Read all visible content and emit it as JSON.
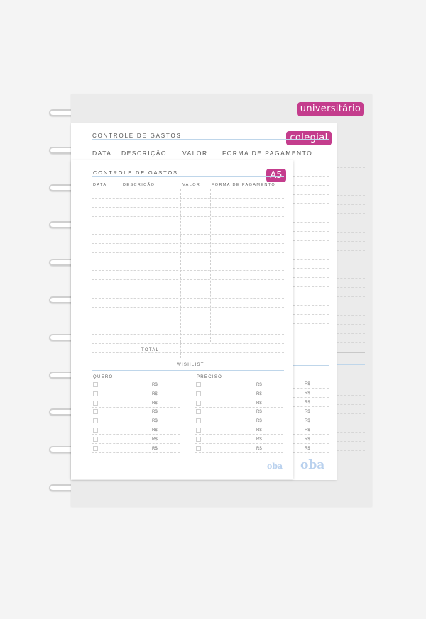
{
  "badges": {
    "universitario": "universitário",
    "colegial": "colegial",
    "a5": "A5"
  },
  "form": {
    "title": "CONTROLE DE GASTOS",
    "columns": [
      "DATA",
      "DESCRIÇÃO",
      "VALOR",
      "FORMA DE PAGAMENTO"
    ],
    "total": "TOTAL",
    "wishlist": "WISHLIST",
    "quero": "QUERO",
    "preciso": "PRECISO",
    "currency": "R$"
  },
  "brand": {
    "logo": "oba"
  },
  "colors": {
    "badge": "#c43d8d",
    "rule": "#bfd6ea",
    "logo": "#b9d1ee"
  }
}
